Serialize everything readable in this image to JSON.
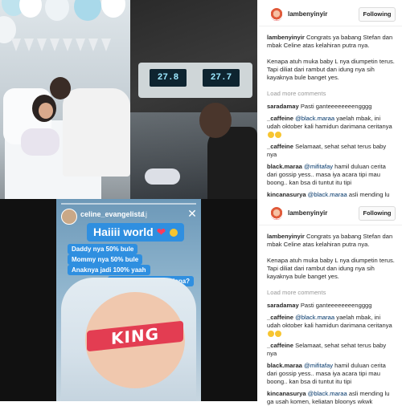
{
  "top_photos": {
    "incubator_monitor": {
      "reading_left": "27.8",
      "reading_right": "27.7"
    }
  },
  "story": {
    "username": "celine_evangelista",
    "time_ago": "1j",
    "close_icon": "close-icon",
    "headline": "Haiiii world",
    "lines": [
      "Daddy nya 50% bule",
      "Mommy nya 50% bule",
      "Anaknya jadi 100% yaah",
      "Ayooo tebak mirip siapa?"
    ],
    "sticker": "KING",
    "accent_color": "#2f8fe0",
    "sticker_color": "#e33d52"
  },
  "ig_post_top": {
    "username": "lambenyinyir",
    "follow_label": "Following",
    "caption_user": "lambenyinyir",
    "caption_text": "Congrats ya babang Stefan dan mbak Celine atas kelahiran putra nya.",
    "paragraph": "Kenapa atuh muka baby L nya diumpetin terus. Tapi diliat dari rambut dan idung nya sih kayaknya bule banget yes.",
    "load_more": "Load more comments",
    "comments": [
      {
        "user": "saradamay",
        "mention": "",
        "text": "Pasti ganteeeeeeeengggg"
      },
      {
        "user": "_caffeine",
        "mention": "@black.maraa",
        "text": "yaelah mbak, ini udah oktober kali hamidun darimana ceritanya"
      },
      {
        "user": "_caffeine",
        "mention": "",
        "text": "Selamaat, sehat sehat terus baby nya"
      },
      {
        "user": "black.maraa",
        "mention": "@mifitafay",
        "text": "hamil duluan cerita dari gossip yess.. masa iya acara tipi mau boong.. kan bsa di tuntut itu tipi"
      },
      {
        "user": "kincanasurya",
        "mention": "@black.maraa",
        "text": "asli mending lu ga usah komen, keliatan bloonys wkwk"
      }
    ]
  },
  "ig_post_bottom": {
    "username": "lambenyinyir",
    "follow_label": "Following",
    "caption_user": "lambenyinyir",
    "caption_text": "Congrats ya babang Stefan dan mbak Celine atas kelahiran putra nya.",
    "paragraph": "Kenapa atuh muka baby L nya diumpetin terus. Tapi diliat dari rambut dan idung nya sih kayaknya bule banget yes.",
    "load_more": "Load more comments",
    "comments": [
      {
        "user": "saradamay",
        "mention": "",
        "text": "Pasti ganteeeeeeeengggg"
      },
      {
        "user": "_caffeine",
        "mention": "@black.maraa",
        "text": "yaelah mbak, ini udah oktober kali hamidun darimana ceritanya"
      },
      {
        "user": "_caffeine",
        "mention": "",
        "text": "Selamaat, sehat sehat terus baby nya"
      },
      {
        "user": "black.maraa",
        "mention": "@mifitafay",
        "text": "hamil duluan cerita dari gossip yess.. masa iya acara tipi mau boong.. kan bsa di tuntut itu tipi"
      },
      {
        "user": "kincanasurya",
        "mention": "@black.maraa",
        "text": "asli mending lu ga usah komen, keliatan bloonys wkwk"
      }
    ]
  }
}
